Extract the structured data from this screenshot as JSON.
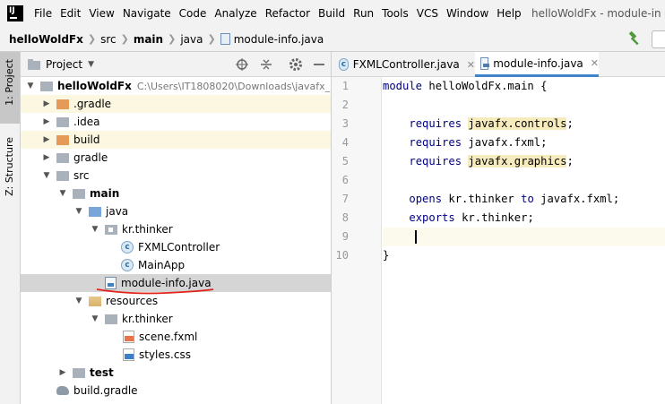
{
  "menubar": {
    "items": [
      "File",
      "Edit",
      "View",
      "Navigate",
      "Code",
      "Analyze",
      "Refactor",
      "Build",
      "Run",
      "Tools",
      "VCS",
      "Window",
      "Help"
    ],
    "window_title": "helloWoldFx - module-in"
  },
  "breadcrumb": {
    "project": "helloWoldFx",
    "src": "src",
    "main": "main",
    "java": "java",
    "file": "module-info.java"
  },
  "stripe": {
    "project_label": "1: Project",
    "structure_label": "Z: Structure"
  },
  "project_panel": {
    "title": "Project",
    "root_name": "helloWoldFx",
    "root_path": "C:\\Users\\IT1808020\\Downloads\\javafx_",
    "nodes": [
      {
        "label": ".gradle"
      },
      {
        "label": ".idea"
      },
      {
        "label": "build"
      },
      {
        "label": "gradle"
      },
      {
        "label": "src"
      },
      {
        "label": "main"
      },
      {
        "label": "java"
      },
      {
        "label": "kr.thinker"
      },
      {
        "label": "FXMLController"
      },
      {
        "label": "MainApp"
      },
      {
        "label": "module-info.java"
      },
      {
        "label": "resources"
      },
      {
        "label": "kr.thinker"
      },
      {
        "label": "scene.fxml"
      },
      {
        "label": "styles.css"
      },
      {
        "label": "test"
      },
      {
        "label": "build.gradle"
      }
    ]
  },
  "tabs": [
    {
      "label": "FXMLController.java"
    },
    {
      "label": "module-info.java"
    }
  ],
  "editor": {
    "line_numbers": [
      "1",
      "2",
      "3",
      "4",
      "5",
      "6",
      "7",
      "8",
      "9",
      "10"
    ],
    "line1": {
      "kw": "module",
      "rest": " helloWoldFx.main {"
    },
    "line3": {
      "kw": "requires",
      "hl": "javafx.controls",
      "end": ";"
    },
    "line4": {
      "kw": "requires",
      "rest": " javafx.fxml;"
    },
    "line5": {
      "kw": "requires",
      "hl": "javafx.graphics",
      "end": ";"
    },
    "line7": {
      "kw": "opens",
      "mid": " kr.thinker ",
      "kw2": "to",
      "rest": " javafx.fxml;"
    },
    "line8": {
      "kw": "exports",
      "rest": " kr.thinker;"
    },
    "line10": {
      "rest": "}"
    }
  }
}
